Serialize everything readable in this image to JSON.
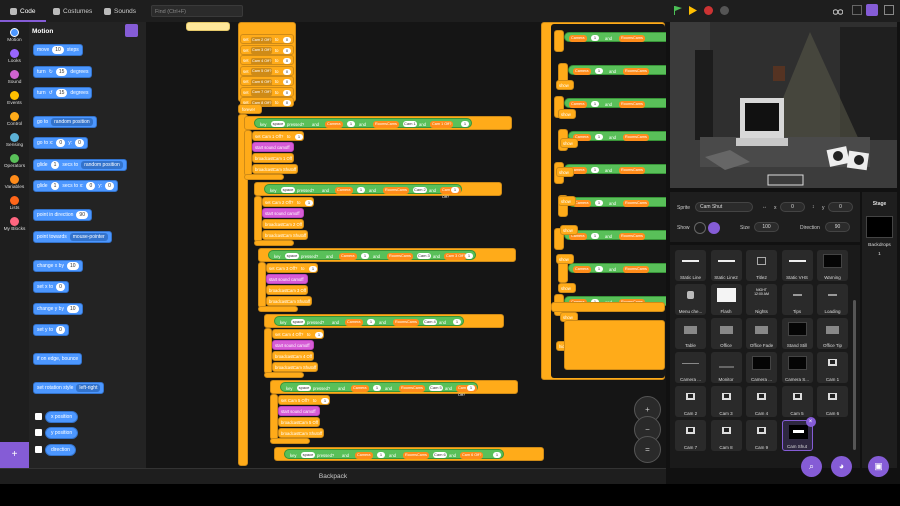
{
  "tabs": [
    {
      "label": "Code"
    },
    {
      "label": "Costumes"
    },
    {
      "label": "Sounds"
    }
  ],
  "find_placeholder": "Find (Ctrl+F)",
  "categories": [
    "Motion",
    "Looks",
    "Sound",
    "Events",
    "Control",
    "Sensing",
    "Operators",
    "Variables",
    "Lists",
    "My Blocks"
  ],
  "category_colors": [
    "#4c97ff",
    "#9966ff",
    "#cf63cf",
    "#ffbf00",
    "#ffab19",
    "#5cb1d6",
    "#59c059",
    "#ff8c1a",
    "#ff661a",
    "#ff6680"
  ],
  "palette": {
    "title": "Motion",
    "move": {
      "a": "move",
      "n": "10",
      "b": "steps"
    },
    "turn_right": {
      "a": "turn",
      "n": "15",
      "b": "degrees"
    },
    "turn_left": {
      "a": "turn",
      "n": "15",
      "b": "degrees"
    },
    "goto": {
      "a": "go to",
      "opt": "random position"
    },
    "goto_xy": {
      "a": "go to x:",
      "x": "0",
      "b": "y:",
      "y": "0"
    },
    "glide": {
      "a": "glide",
      "n": "1",
      "b": "secs to",
      "opt": "random position"
    },
    "glide_xy": {
      "a": "glide",
      "n": "1",
      "b": "secs to x:",
      "x": "0",
      "c": "y:",
      "y": "0"
    },
    "point_dir": {
      "a": "point in direction",
      "n": "90"
    },
    "point_towards": {
      "a": "point towards",
      "opt": "mouse-pointer"
    },
    "change_x": {
      "a": "change x by",
      "n": "10"
    },
    "set_x": {
      "a": "set x to",
      "n": "0"
    },
    "change_y": {
      "a": "change y by",
      "n": "10"
    },
    "set_y": {
      "a": "set y to",
      "n": "0"
    },
    "bounce": "if on edge, bounce",
    "rot_style": {
      "a": "set rotation style",
      "opt": "left-right"
    },
    "rep_x": "x position",
    "rep_y": "y position",
    "rep_dir": "direction"
  },
  "scripts": {
    "set_rows": [
      {
        "a": "set",
        "v": "Cam 2 Off?",
        "b": "to",
        "n": "0"
      },
      {
        "a": "set",
        "v": "Cam 3 Off?",
        "b": "to",
        "n": "0"
      },
      {
        "a": "set",
        "v": "Cam 4 Off?",
        "b": "to",
        "n": "0"
      },
      {
        "a": "set",
        "v": "Cam 5 Off?",
        "b": "to",
        "n": "0"
      },
      {
        "a": "set",
        "v": "Cam 6 Off?",
        "b": "to",
        "n": "0"
      },
      {
        "a": "set",
        "v": "Cam 7 Off?",
        "b": "to",
        "n": "0"
      },
      {
        "a": "set",
        "v": "Cam 8 Off?",
        "b": "to",
        "n": "0"
      }
    ],
    "forever": "forever",
    "conds": [
      {
        "key": "key",
        "k": "space",
        "p": "pressed?",
        "and": "and",
        "v": "Camera",
        "n": "1",
        "v2": "RoomsCams",
        "n2": "Cam 1",
        "v3": "Cam 1 Off?",
        "n3": "1"
      },
      {
        "key": "key",
        "k": "space",
        "p": "pressed?",
        "and": "and",
        "v": "Camera",
        "n": "1",
        "v2": "RoomsCams",
        "n2": "Cam 2",
        "v3": "Cam 2 Off?",
        "n3": "1"
      },
      {
        "key": "key",
        "k": "space",
        "p": "pressed?",
        "and": "and",
        "v": "Camera",
        "n": "1",
        "v2": "RoomsCams",
        "n2": "Cam 3",
        "v3": "Cam 3 Off?",
        "n3": "1"
      },
      {
        "key": "key",
        "k": "space",
        "p": "pressed?",
        "and": "and",
        "v": "Camera",
        "n": "1",
        "v2": "RoomsCams",
        "n2": "Cam 4",
        "v3": "Cam 4 Off?",
        "n3": "1"
      },
      {
        "key": "key",
        "k": "space",
        "p": "pressed?",
        "and": "and",
        "v": "Camera",
        "n": "1",
        "v2": "RoomsCams",
        "n2": "Cam 5",
        "v3": "Cam 5 Off?",
        "n3": "1"
      },
      {
        "key": "key",
        "k": "space",
        "p": "pressed?",
        "and": "and",
        "v": "Camera",
        "n": "1",
        "v2": "RoomsCams",
        "n2": "Cam 6",
        "v3": "Cam 6 Off?",
        "n3": "1"
      }
    ],
    "inner": [
      {
        "set": "set",
        "var": "Cam 1 Off?",
        "to": "to",
        "n": "1",
        "sound": "start sound",
        "snd": "camoff",
        "bc": "broadcast",
        "msg1": "Cam 1 Off",
        "msg2": "Cam Shutoff"
      },
      {
        "set": "set",
        "var": "Cam 2 Off?",
        "to": "to",
        "n": "1",
        "sound": "start sound",
        "snd": "camoff",
        "bc": "broadcast",
        "msg1": "Cam 2 Off",
        "msg2": "Cam Shutoff"
      },
      {
        "set": "set",
        "var": "Cam 3 Off?",
        "to": "to",
        "n": "1",
        "sound": "start sound",
        "snd": "camoff",
        "bc": "broadcast",
        "msg1": "Cam 3 Off",
        "msg2": "Cam Shutoff"
      },
      {
        "set": "set",
        "var": "Cam 4 Off?",
        "to": "to",
        "n": "1",
        "sound": "start sound",
        "snd": "camoff",
        "bc": "broadcast",
        "msg1": "Cam 4 Off",
        "msg2": "Cam Shutoff"
      },
      {
        "set": "set",
        "var": "Cam 5 Off?",
        "to": "to",
        "n": "1",
        "sound": "start sound",
        "snd": "camoff",
        "bc": "broadcast",
        "msg1": "Cam 5 Off",
        "msg2": "Cam Shutoff"
      }
    ],
    "right_rows": [
      {
        "v": "Camera",
        "n": "1",
        "and": "and",
        "v2": "RoomsCams"
      },
      {
        "v": "Camera",
        "n": "1",
        "and": "and",
        "v2": "RoomsCams"
      },
      {
        "v": "Camera",
        "n": "1",
        "and": "and",
        "v2": "RoomsCams"
      },
      {
        "v": "Camera",
        "n": "1",
        "and": "and",
        "v2": "RoomsCams"
      },
      {
        "v": "Camera",
        "n": "1",
        "and": "and",
        "v2": "RoomsCams"
      },
      {
        "v": "Camera",
        "n": "1",
        "and": "and",
        "v2": "RoomsCams"
      },
      {
        "v": "Camera",
        "n": "1",
        "and": "and",
        "v2": "RoomsCams"
      },
      {
        "v": "Camera",
        "n": "1",
        "and": "and",
        "v2": "RoomsCams"
      },
      {
        "v": "Camera",
        "n": "1",
        "and": "and",
        "v2": "RoomsCams"
      }
    ],
    "right_side": [
      "show",
      "show",
      "show",
      "show",
      "show",
      "show",
      "show",
      "show",
      "show",
      "hide"
    ]
  },
  "backpack": "Backpack",
  "sprite_info": {
    "sprite_label": "Sprite",
    "sprite_name": "Cam Shut",
    "x_label": "x",
    "x": "0",
    "y_label": "y",
    "y": "0",
    "show_label": "Show",
    "size_label": "Size",
    "size": "100",
    "direction_label": "Direction",
    "direction": "90"
  },
  "sprites": [
    "Static Line",
    "Static Line2",
    "Title2",
    "Static VHS",
    "Warning",
    "Menu che...",
    "Flash",
    "Nights",
    "Tips",
    "Loading",
    "Table",
    "Office",
    "Office Fade",
    "Stand Still",
    "Office Tip",
    "Camera ...",
    "Monitor",
    "Camera ...",
    "Camera S...",
    "Cam 1",
    "Cam 2",
    "Cam 3",
    "Cam 4",
    "Cam 5",
    "Cam 6",
    "Cam 7",
    "Cam 8",
    "Cam 9",
    "Cam Shut"
  ],
  "nights_thumb": {
    "line1": "NIGHT",
    "line2": "12:00 AM"
  },
  "stage_pane": {
    "title": "Stage",
    "backdrops_label": "Backdrops",
    "backdrops_count": "1"
  },
  "colors": {
    "motion": "#4c97ff",
    "control": "#ffab19",
    "operators": "#59c059",
    "sound": "#cf63cf",
    "accent": "#855cd6"
  }
}
